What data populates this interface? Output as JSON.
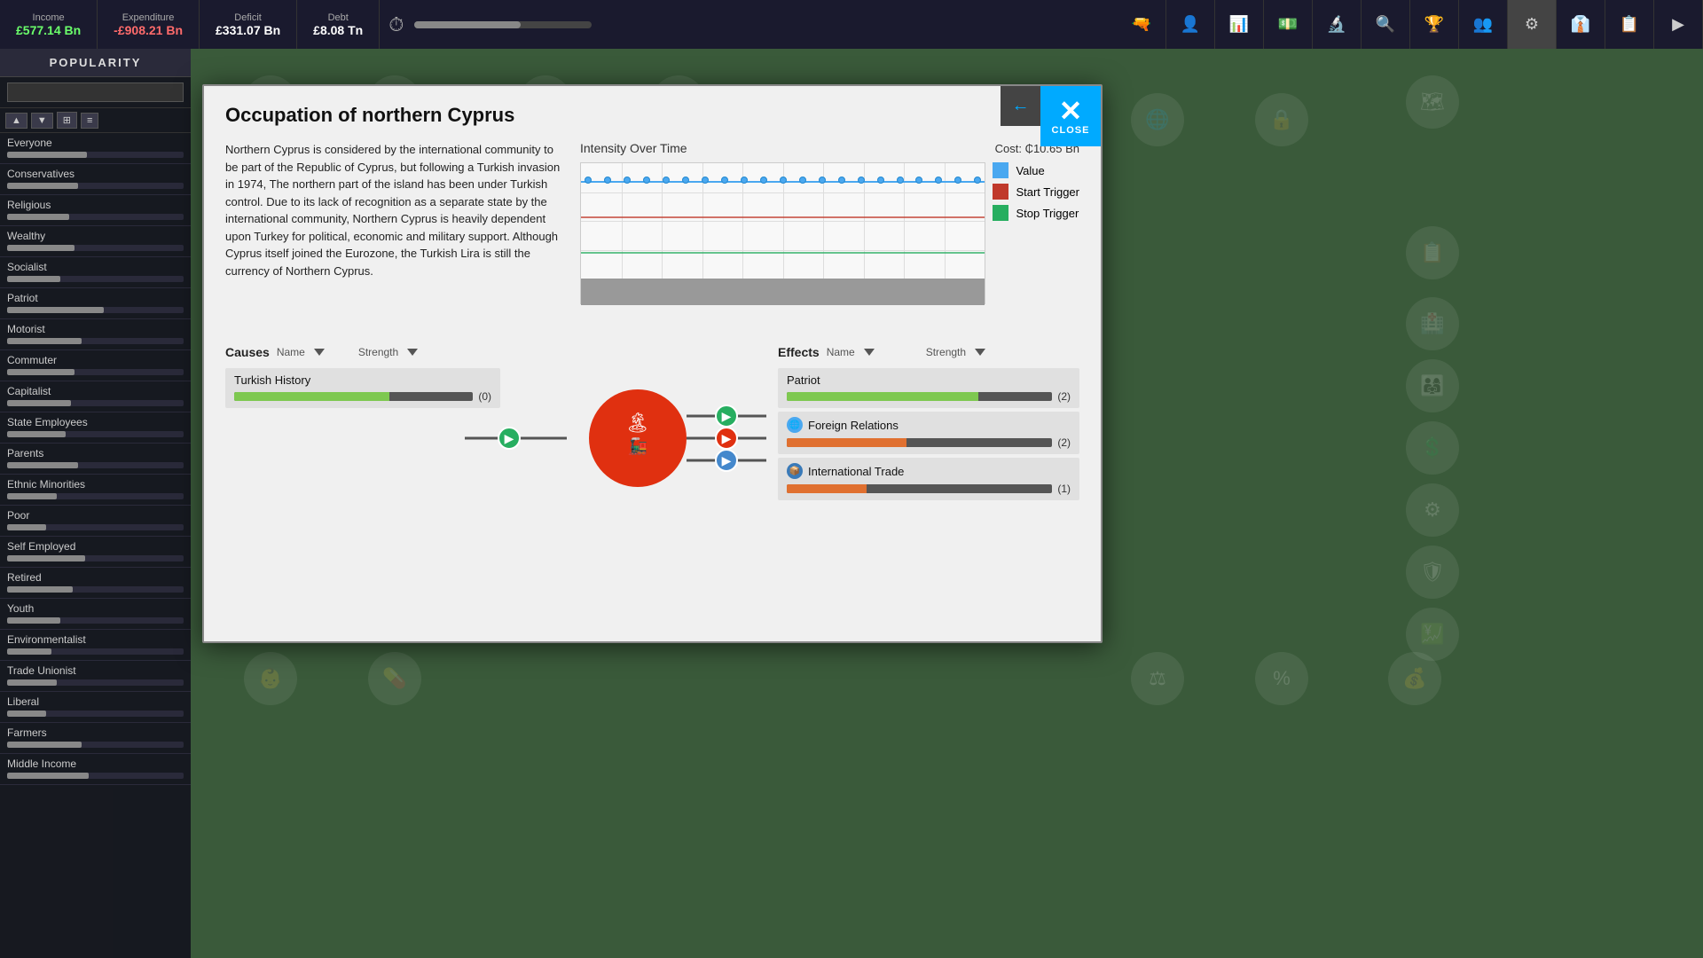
{
  "topbar": {
    "stats": [
      {
        "label": "Income",
        "value": "£577.14 Bn",
        "type": "positive"
      },
      {
        "label": "Expenditure",
        "value": "-£908.21 Bn",
        "type": "negative"
      },
      {
        "label": "Deficit",
        "value": "£331.07 Bn",
        "type": "neutral"
      },
      {
        "label": "Debt",
        "value": "£8.08 Tn",
        "type": "neutral"
      }
    ],
    "icons": [
      "⏱",
      "🔫",
      "👥",
      "📊",
      "💵",
      "🔬",
      "🔍",
      "🏆",
      "👤",
      "⚙",
      "👔",
      "📋",
      "▶"
    ]
  },
  "sidebar": {
    "title": "POPULARITY",
    "search_placeholder": "",
    "groups": [
      {
        "name": "Everyone",
        "fill": 45
      },
      {
        "name": "Conservatives",
        "fill": 40
      },
      {
        "name": "Religious",
        "fill": 35
      },
      {
        "name": "Wealthy",
        "fill": 38
      },
      {
        "name": "Socialist",
        "fill": 30
      },
      {
        "name": "Patriot",
        "fill": 55
      },
      {
        "name": "Motorist",
        "fill": 42
      },
      {
        "name": "Commuter",
        "fill": 38
      },
      {
        "name": "Capitalist",
        "fill": 36
      },
      {
        "name": "State Employees",
        "fill": 33
      },
      {
        "name": "Parents",
        "fill": 40
      },
      {
        "name": "Ethnic Minorities",
        "fill": 28
      },
      {
        "name": "Poor",
        "fill": 22
      },
      {
        "name": "Self Employed",
        "fill": 44
      },
      {
        "name": "Retired",
        "fill": 37
      },
      {
        "name": "Youth",
        "fill": 30
      },
      {
        "name": "Environmentalist",
        "fill": 25
      },
      {
        "name": "Trade Unionist",
        "fill": 28
      },
      {
        "name": "Liberal",
        "fill": 22
      },
      {
        "name": "Farmers",
        "fill": 42
      },
      {
        "name": "Middle Income",
        "fill": 46
      }
    ]
  },
  "modal": {
    "title": "Occupation of northern Cyprus",
    "description": "Northern Cyprus is considered by the international community to be part of the Republic of Cyprus, but following a Turkish invasion in 1974, The northern part of the island has been under Turkish control. Due to its lack of recognition as a separate state by the international community, Northern Cyprus is heavily dependent upon Turkey for political, economic and military support. Although Cyprus itself joined the Eurozone, the Turkish Lira is still the currency of Northern Cyprus.",
    "chart": {
      "title": "Intensity Over Time",
      "cost": "Cost: ₵10.65 Bn",
      "legend": [
        {
          "label": "Value",
          "color": "blue"
        },
        {
          "label": "Start Trigger",
          "color": "red"
        },
        {
          "label": "Stop Trigger",
          "color": "green"
        }
      ]
    },
    "causes": {
      "section_title": "Causes",
      "name_col": "Name",
      "strength_col": "Strength",
      "items": [
        {
          "name": "Turkish History",
          "fill": 65,
          "value": "(0)"
        }
      ]
    },
    "effects": {
      "section_title": "Effects",
      "name_col": "Name",
      "strength_col": "Strength",
      "items": [
        {
          "name": "Patriot",
          "fill_pct": 72,
          "fill_color": "green",
          "value": "(2)",
          "icon": "none"
        },
        {
          "name": "Foreign Relations",
          "fill_pct": 45,
          "fill_color": "orange",
          "value": "(2)",
          "icon": "globe"
        },
        {
          "name": "International Trade",
          "fill_pct": 30,
          "fill_color": "orange2",
          "value": "(1)",
          "icon": "trade"
        }
      ]
    },
    "close_label": "CLOSE",
    "back_arrow": "←"
  }
}
